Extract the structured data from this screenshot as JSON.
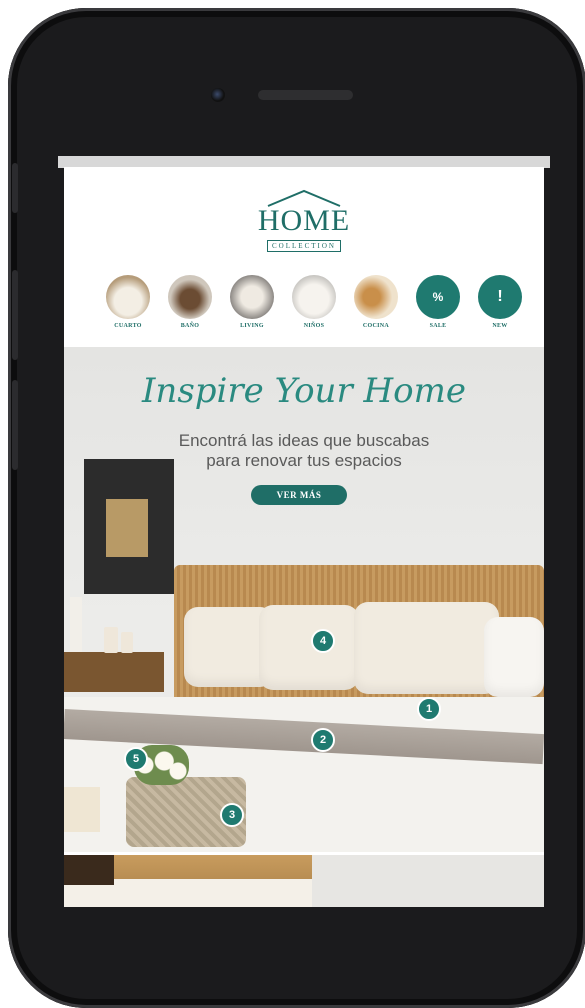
{
  "brand": {
    "logo_word": "HOME",
    "logo_sub": "COLLECTION"
  },
  "categories": [
    {
      "label": "CUARTO",
      "icon": "bedroom-photo-icon"
    },
    {
      "label": "BAÑO",
      "icon": "bathroom-photo-icon"
    },
    {
      "label": "LIVING",
      "icon": "living-photo-icon"
    },
    {
      "label": "NIÑOS",
      "icon": "kids-photo-icon"
    },
    {
      "label": "COCINA",
      "icon": "kitchen-photo-icon"
    },
    {
      "label": "SALE",
      "icon": "percent-icon",
      "glyph": "%"
    },
    {
      "label": "NEW",
      "icon": "exclamation-icon",
      "glyph": "!"
    }
  ],
  "hero": {
    "title": "Inspire Your Home",
    "subtitle_line1": "Encontrá las ideas que buscabas",
    "subtitle_line2": "para renovar tus espacios",
    "cta_label": "VER MÁS"
  },
  "hotspots": [
    "1",
    "2",
    "3",
    "4",
    "5"
  ],
  "colors": {
    "accent": "#1f6e67",
    "title_teal": "#2a8a80"
  }
}
